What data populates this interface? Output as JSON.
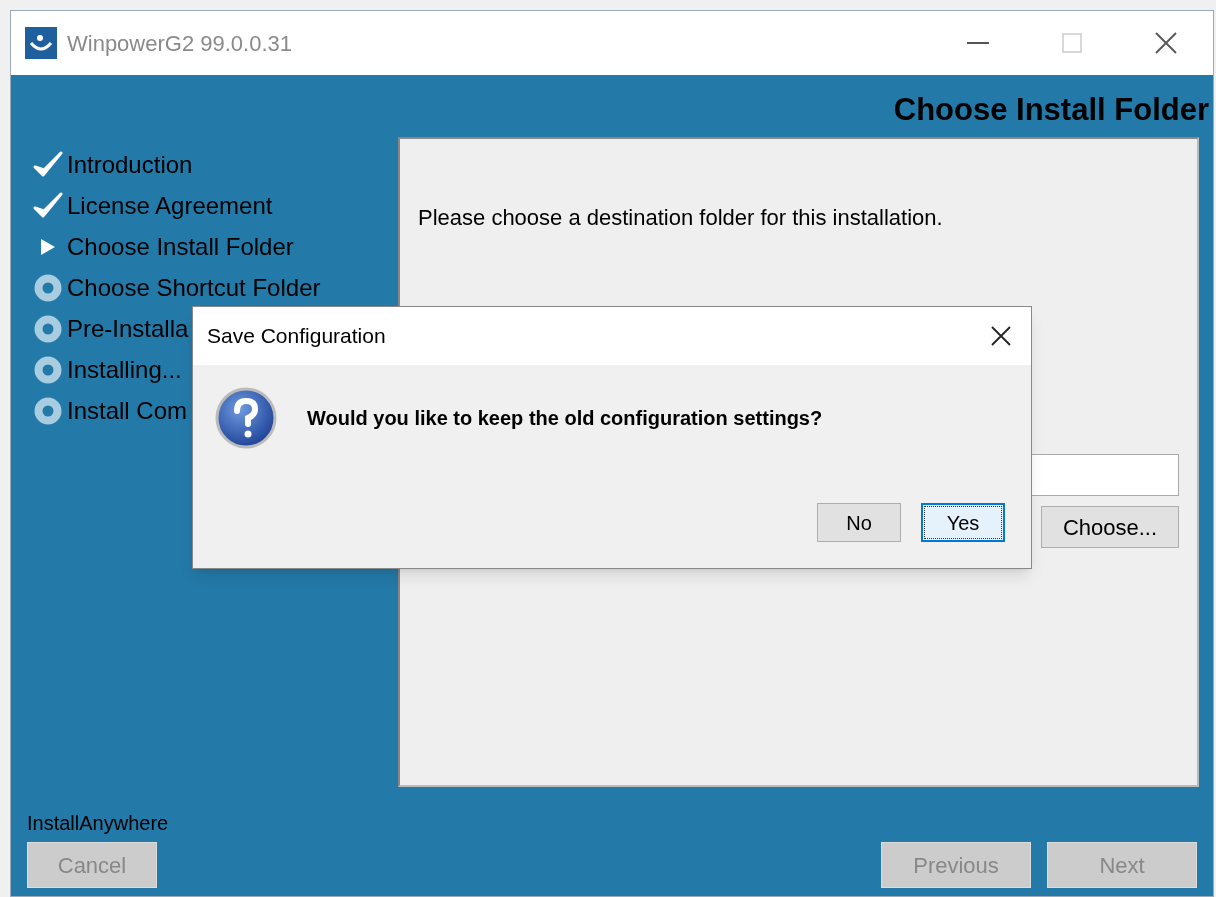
{
  "window": {
    "title": "WinpowerG2 99.0.0.31"
  },
  "heading": "Choose Install Folder",
  "steps": [
    {
      "label": "Introduction",
      "kind": "done"
    },
    {
      "label": "License Agreement",
      "kind": "done"
    },
    {
      "label": "Choose Install Folder",
      "kind": "current"
    },
    {
      "label": "Choose Shortcut Folder",
      "kind": "pending"
    },
    {
      "label": "Pre-Installa",
      "kind": "pending"
    },
    {
      "label": "Installing...",
      "kind": "pending"
    },
    {
      "label": "Install Com",
      "kind": "pending"
    }
  ],
  "content": {
    "instruction": "Please choose a destination folder for this installation.",
    "choose_button": "Choose..."
  },
  "vendor": "InstallAnywhere",
  "footer_buttons": [
    {
      "label": "Cancel",
      "disabled": true,
      "kind": "left"
    },
    {
      "label": "Previous",
      "disabled": true,
      "kind": "right"
    },
    {
      "label": "Next",
      "disabled": true,
      "kind": "right"
    }
  ],
  "dialog": {
    "title": "Save Configuration",
    "message": "Would you like to keep the old configuration settings?",
    "buttons": [
      {
        "label": "No",
        "default": false
      },
      {
        "label": "Yes",
        "default": true
      }
    ]
  }
}
